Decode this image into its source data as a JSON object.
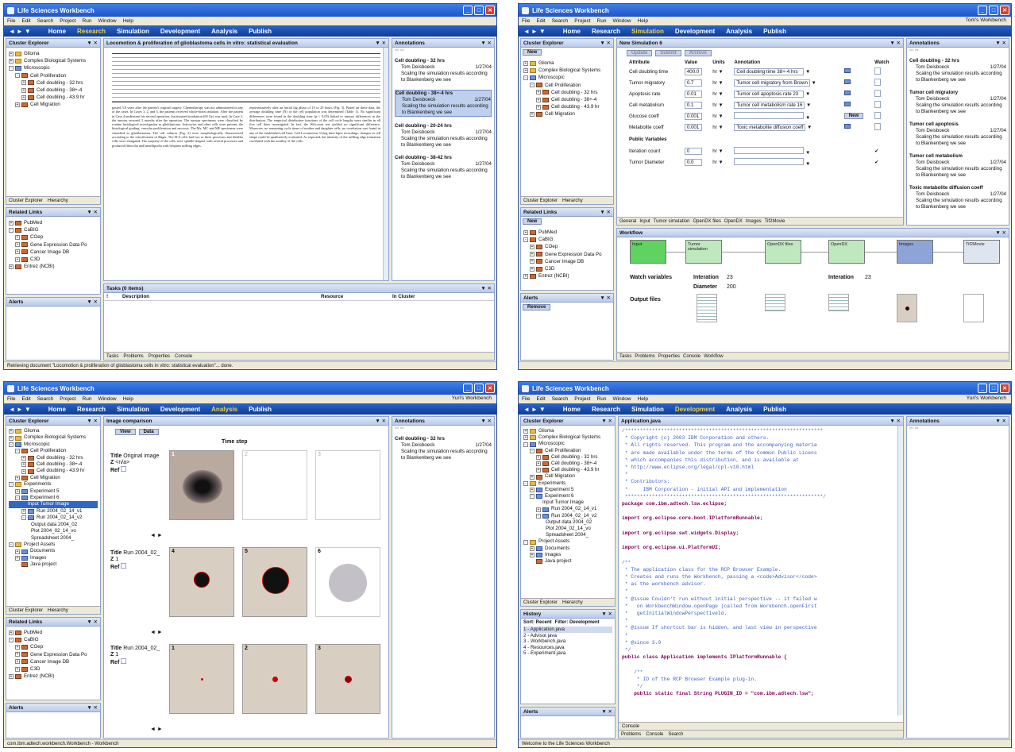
{
  "app_title": "Life Sciences Workbench",
  "menu": [
    "File",
    "Edit",
    "Search",
    "Project",
    "Run",
    "Window",
    "Help"
  ],
  "nav": [
    "Home",
    "Research",
    "Simulation",
    "Development",
    "Analysis",
    "Publish"
  ],
  "win1": {
    "cluster_title": "Cluster Explorer",
    "tree": [
      "Glioma",
      "Complex Biological Systems",
      "Microscopic",
      "Cell Proliferation",
      "Cell doubling - 32 hrs",
      "Cell doubling - 38+-4",
      "Cell doubling - 43.9 hr",
      "Cell Migration"
    ],
    "bottom_tabs": [
      "Cluster Explorer",
      "Hierarchy"
    ],
    "related_title": "Related Links",
    "related": [
      "PubMed",
      "CaBIG",
      "COep",
      "Gene Expression Data Po",
      "Cancer Image DB",
      "C3D",
      "Entrez (NCBI)"
    ],
    "alerts_title": "Alerts",
    "doc_title": "Locomotion & proliferation of glioblastoma cells in vitro: statistical evaluation",
    "doc_text_a": "passed 5.8 years after the patient's original surgery. Chemotherapy was not administered in any of the cases. In Cases 1, 2, and 3, the patients received whole-brain radiation. After the patient in Case 4 underwent his second operation, fractionated irradiation (60 Gy) was used. In Case 2, the tumour recurred 2 months after the operation. The tumour specimens were classified by routine histological investigation as glioblastoma. Astrocytes and other cells were present; the histological grading, vascular proliferation and necrosis. The Ms, MC and MF specimens were classified as glioblastomas. The cell cultures (Fig. 2) were morphologically characterized according to the classification of Hager. The H-A cells had two or three processes and fibrillar cells were elongated. The majority of the cells were spindle-shaped, with several processes and produced fibrocilia and lamellipodia with frequent ruffling edges.",
    "doc_text_b": "representatively after an initial lag phase of 19 to 20 hours (Fig. 3). Based on these data, the average doubling time (N) of the cell population was determined (Table 1). No significant differences were found in the doubling time (p < 0.05) linked to tumour differences in the distribution. The empirical distribution functions of the cell cycle lengths were similar in all five cell lines investigated. In fact, the Wilcoxon test yielded no significant difference. Moreover, no remaining cycle times of mother and daughter cells, no correlation was found in any of the established cell lines. Cell Locomotion. Using time-lapse recordings, changes in cell shape could be qualitatively evaluated. As expected, the intensity of the ruffling edge formation correlated with the motility of the cells.",
    "annotations_title": "Annotations",
    "annotations": [
      {
        "t": "Cell doubling - 32 hrs",
        "a": "Tom Deisboeck",
        "d": "1/27/04",
        "x": "Scaling the simulation results according to Blankenberg we see"
      },
      {
        "t": "Cell doubling - 38+-4 hrs",
        "a": "Tom Deisboeck",
        "d": "1/27/04",
        "x": "Scaling the simulation results according to Blankenberg we see"
      },
      {
        "t": "Cell doubling - 20-24 hrs",
        "a": "Tom Deisboeck",
        "d": "1/27/04",
        "x": "Scaling the simulation results according to Blankenberg we see"
      },
      {
        "t": "Cell doubling - 38-42 hrs",
        "a": "Tom Deisboeck",
        "d": "1/27/04",
        "x": "Scaling the simulation results according to Blankenberg we see"
      }
    ],
    "tasks_title": "Tasks (0 items)",
    "tasks_cols": [
      "!",
      "Description",
      "Resource",
      "In Cluster"
    ],
    "tasks_tabs": [
      "Tasks",
      "Problems",
      "Properties",
      "Console"
    ],
    "status": "Retrieving document \"Locomotion & proliferation of glioblastoma cells in vitro: statistical evaluation\"... done."
  },
  "win2": {
    "user": "Tom's Workbench",
    "new_btn": "New",
    "sim_title": "New Simulation 6",
    "sim_buttons": [
      "Update",
      "Submit",
      "Archive"
    ],
    "cols": [
      "Attribute",
      "Value",
      "Units",
      "Annotation",
      "Watch"
    ],
    "rows": [
      {
        "a": "Cell doubling time",
        "v": "400.0",
        "u": "hr",
        "n": "Cell doubling time 38+-4 hrs"
      },
      {
        "a": "Tumor migratory",
        "v": "0.7",
        "u": "hr",
        "n": "Tumor cell migratory from Brown"
      },
      {
        "a": "Apoptosis rate",
        "v": "0.01",
        "u": "hr",
        "n": "Tumor cell apoptosis rate 23"
      },
      {
        "a": "Cell metabolism",
        "v": "0.1",
        "u": "hr",
        "n": "Tumor cell metabolism rate 16"
      },
      {
        "a": "Glucose coeff",
        "v": "0.001",
        "u": "hr",
        "n": ""
      },
      {
        "a": "Metabolite coeff",
        "v": "0.001",
        "u": "hr",
        "n": "Toxic metabolite diffusion coeff"
      }
    ],
    "public_vars": "Public Variables",
    "pv_rows": [
      {
        "a": "Iteration count",
        "v": "0",
        "u": "hr"
      },
      {
        "a": "Tumor Diameter",
        "v": "0.0",
        "u": "hr"
      }
    ],
    "tabs": [
      "General",
      "Input",
      "Tumor simulation",
      "OpenDX files",
      "OpenDX",
      "Images",
      "Tif2Movie"
    ],
    "workflow_title": "Workflow",
    "wf_nodes": [
      "Input",
      "Tumor simulation",
      "OpenDX files",
      "OpenDX",
      "Images",
      "Tif2Movie"
    ],
    "watch_label": "Watch variables",
    "iteration_label": "Interation",
    "iteration_val": "23",
    "iteration_label2": "Interation",
    "iteration_val2": "23",
    "diameter_label": "Diameter",
    "diameter_val": "200",
    "output_label": "Output files",
    "bottom_tabs": [
      "Tasks",
      "Problems",
      "Properties",
      "Console",
      "Workflow"
    ],
    "alerts_btn": "Remove",
    "annotations": [
      {
        "t": "Cell doubling - 32 hrs",
        "a": "Tom Deisboeck",
        "d": "1/27/04",
        "x": "Scaling the simulation results according to Blankenberg we see"
      },
      {
        "t": "Tumor cell migratory",
        "a": "Tom Deisboeck",
        "d": "1/27/04",
        "x": "Scaling the simulation results according to Blankenberg we see"
      },
      {
        "t": "Tumor cell apoptosis",
        "a": "Tom Deisboeck",
        "d": "1/27/04",
        "x": "Scaling the simulation results according to Blankenberg we see"
      },
      {
        "t": "Tumor cell metabolism",
        "a": "Tom Deisboeck",
        "d": "1/27/04",
        "x": "Scaling the simulation results according to Blankenberg we see"
      },
      {
        "t": "Toxic metabolite diffusion coeff",
        "a": "Tom Deisboeck",
        "d": "1/27/04",
        "x": "Scaling the simulation results according to Blankenberg we see"
      }
    ]
  },
  "win3": {
    "user": "Yuri's Workbench",
    "tree": [
      "Glioma",
      "Complex Biological Systems",
      "Microscopic",
      "Cell Proliferation",
      "Cell doubling - 32 hrs",
      "Cell doubling - 38+-4",
      "Cell doubling - 43.9 hr",
      "Cell Migration",
      "Experiments",
      "Experiment 5",
      "Experiment 6",
      "Input Tumor Image",
      "Run 2004_02_14_v1",
      "Run 2004_02_14_v2",
      "Output data 2004_02",
      "Plot 2004_02_14_vo",
      "Spreadsheet 2004_",
      "Project Assets",
      "Documents",
      "Images",
      "Java project"
    ],
    "comp_title": "Image comparison",
    "comp_tabs": [
      "View",
      "Data"
    ],
    "time_step": "Time step",
    "rows": [
      {
        "title": "Title",
        "name": "Original image",
        "z": "Z",
        "ref": "Ref",
        "zv": "<n/a>",
        "rv": ""
      },
      {
        "title": "Title",
        "name": "Run 2004_02_",
        "z": "Z",
        "ref": "Ref",
        "zv": "1",
        "rv": ""
      },
      {
        "title": "Title",
        "name": "Run 2004_02_",
        "z": "Z",
        "ref": "Ref",
        "zv": "1",
        "rv": ""
      }
    ],
    "frame_nums": [
      "1",
      "2",
      "3",
      "4",
      "5",
      "6",
      "1",
      "2",
      "3"
    ],
    "status": "com.ibm.adtech.workbench.Workbench - Workbench",
    "annotations": [
      {
        "t": "Cell doubling - 32 hrs",
        "a": "Tom Deisboeck",
        "d": "1/27/04",
        "x": "Scaling the simulation results according to Blankenberg we see"
      }
    ]
  },
  "win4": {
    "user": "Yuri's Workbench",
    "editor_title": "Application.java",
    "history_title": "History",
    "history_sort": "Sort: Recent",
    "history_filter": "Filter: Development",
    "history": [
      "1 - Application.java",
      "2 - Advisor.java",
      "3 - Workbench.java",
      "4 - Resources.java",
      "5 - Experiment.java"
    ],
    "code": [
      "/******************************************************************",
      " * Copyright (c) 2003 IBM Corporation and others.",
      " * All rights reserved. This program and the accompanying materia",
      " * are made available under the terms of the Common Public Licens",
      " * which accompanies this distribution, and is available at",
      " * http://www.eclipse.org/legal/cpl-v10.html",
      " *",
      " * Contributors:",
      " *     IBM Corporation - initial API and implementation",
      " ******************************************************************/",
      "package com.ibm.adtech.lsw.eclipse;",
      "",
      "import org.eclipse.core.boot.IPlatformRunnable;",
      "",
      "import org.eclipse.swt.widgets.Display;",
      "",
      "import org.eclipse.ui.PlatformUI;",
      "",
      "/**",
      " * The application class for the RCP Browser Example.",
      " * Creates and runs the Workbench, passing a <code>Advisor</code>",
      " * as the workbench advisor.",
      " *",
      " * @issue Couldn't run without initial perspective -- it failed w",
      " *   on WorkbenchWindow.openPage (called from Workbench.openFirst",
      " *   getInitialWindowPerspectiveId.",
      " *",
      " * @issue If shortcut bar is hidden, and last view in perspective",
      " *",
      " * @since 3.0",
      " */",
      "public class Application implements IPlatformRunnable {",
      "",
      "    /**",
      "     * ID of the RCP Browser Example plug-in.",
      "     */",
      "    public static final String PLUGIN_ID = \"com.ibm.adtech.lsw\";"
    ],
    "console_tab": "Console",
    "bottom_tabs": [
      "Problems",
      "Console",
      "Search"
    ],
    "status": "Welcome to the Life Sciences Workbench"
  }
}
